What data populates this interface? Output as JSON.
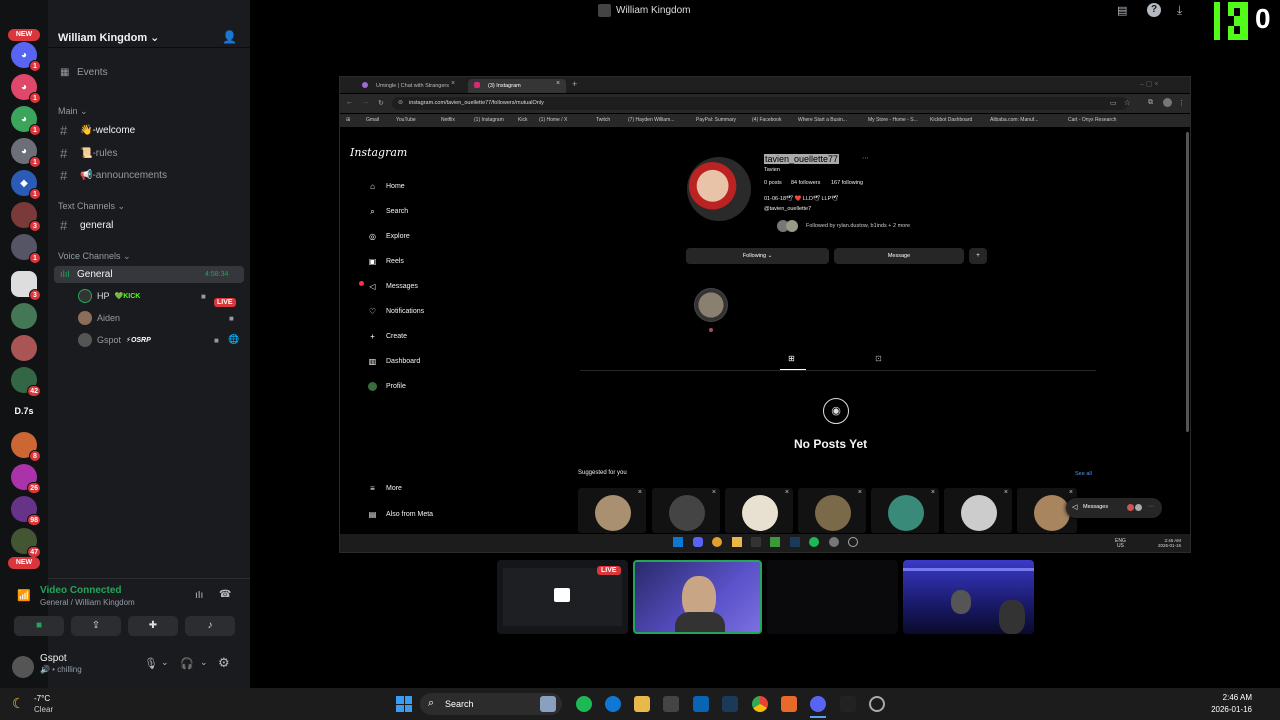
{
  "window": {
    "title": "William Kingdom"
  },
  "server_rail": {
    "new_top": "NEW",
    "new_bottom": "NEW",
    "d7s_label": "D.7s",
    "badges": [
      "1",
      "1",
      "1",
      "1",
      "1",
      "3",
      "1",
      "3",
      "42",
      "8",
      "26",
      "98",
      "47"
    ]
  },
  "guild": {
    "name": "William Kingdom",
    "events_label": "Events",
    "main_category": "Main",
    "channels_main": [
      "👋-welcome",
      "📜-rules",
      "📢-announcements"
    ],
    "text_category": "Text Channels",
    "text_channels": [
      "general"
    ],
    "voice_category": "Voice Channels",
    "voice_channel": {
      "name": "General",
      "timer": "4:58:34"
    },
    "voice_users": [
      {
        "name": "HP",
        "tag": "KICK",
        "live": "LIVE"
      },
      {
        "name": "Aiden",
        "tag": ""
      },
      {
        "name": "Gspot",
        "tag": "OSRP"
      }
    ]
  },
  "voice_panel": {
    "status": "Video Connected",
    "location": "General / William Kingdom"
  },
  "user_panel": {
    "username": "Gspot",
    "status": "chilling"
  },
  "kick_overlay": {
    "count": "0"
  },
  "browser": {
    "tabs": [
      {
        "label": "Umingle | Chat with Strangers"
      },
      {
        "label": "(3) Instagram"
      }
    ],
    "url": "instagram.com/tavien_ouellette77/followers/mutualOnly",
    "bookmarks": [
      "Gmail",
      "YouTube",
      "Netflix",
      "(1) Instagram",
      "Kick",
      "(1) Home / X",
      "Twitch",
      "(7) Hayden William...",
      "PayPal: Summary",
      "(4) Facebook",
      "Where Start a Busin...",
      "My Store - Home - S...",
      "Kickbot Dashboard",
      "Alibaba.com: Manuf...",
      "Cart - Onyx Research"
    ]
  },
  "instagram": {
    "logo": "Instagram",
    "nav": [
      "Home",
      "Search",
      "Explore",
      "Reels",
      "Messages",
      "Notifications",
      "Create",
      "Dashboard",
      "Profile"
    ],
    "nav_bottom": [
      "More",
      "Also from Meta"
    ],
    "profile": {
      "username": "tavien_ouellette77",
      "display_name": "Tavien",
      "posts": "0 posts",
      "followers": "84 followers",
      "following": "167 following",
      "bio_line1": "01-06-18🕊 ❤️ LLD🕊 LLP🕊",
      "bio_line2": "@tavien_ouellette7",
      "followed_by": "Followed by rylan.dustow, b1inds + 2 more",
      "following_button": "Following",
      "message_button": "Message"
    },
    "no_posts": "No Posts Yet",
    "suggested_label": "Suggested for you",
    "see_all": "See all",
    "messages_pill": "Messages"
  },
  "stream_tiles": {
    "live_label": "LIVE"
  },
  "system_taskbar": {
    "weather_temp": "-7°C",
    "weather_desc": "Clear",
    "search_label": "Search",
    "time": "2:46 AM",
    "date": "2026-01-16"
  },
  "inner_taskbar": {
    "lang": "ENG",
    "region": "US",
    "time": "2:46 AM",
    "date": "2026-01-16"
  }
}
